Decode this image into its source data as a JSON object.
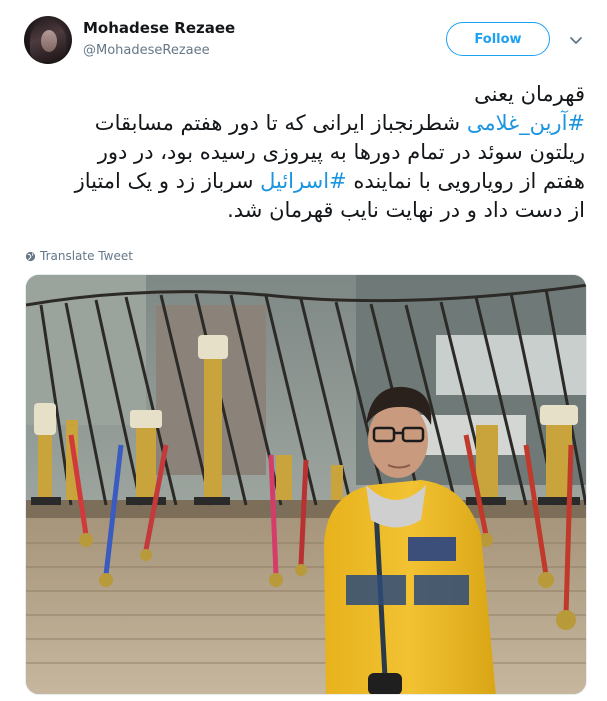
{
  "tweet": {
    "author_name": "Mohadese Rezaee",
    "author_handle": "@MohadeseRezaee",
    "follow_label": "Follow",
    "text_lines": [
      {
        "parts": [
          {
            "text": "قهرمان یعنی",
            "tag": false
          }
        ]
      },
      {
        "parts": [
          {
            "text": "#آرین_غلامی",
            "tag": true
          },
          {
            "text": " شطرنجباز ایرانی که تا دور هفتم مسابقات",
            "tag": false
          }
        ]
      },
      {
        "parts": [
          {
            "text": "ریلتون سوئد در تمام دورها به پیروزی رسیده بود، در دور",
            "tag": false
          }
        ]
      },
      {
        "parts": [
          {
            "text": "هفتم از رویارویی با نماینده ",
            "tag": false
          },
          {
            "text": "#اسرائیل",
            "tag": true
          },
          {
            "text": " سرباز زد و یک امتیاز",
            "tag": false
          }
        ]
      },
      {
        "parts": [
          {
            "text": "از دست داد و در نهایت نایب قهرمان شد.",
            "tag": false
          }
        ]
      }
    ],
    "translate_label": "Translate Tweet",
    "icons": {
      "avatar": "avatar-image",
      "more": "chevron-down-icon",
      "translate": "globe-icon"
    },
    "colors": {
      "link": "#1b95e0",
      "follow": "#1da1f2",
      "muted": "#657786"
    }
  }
}
